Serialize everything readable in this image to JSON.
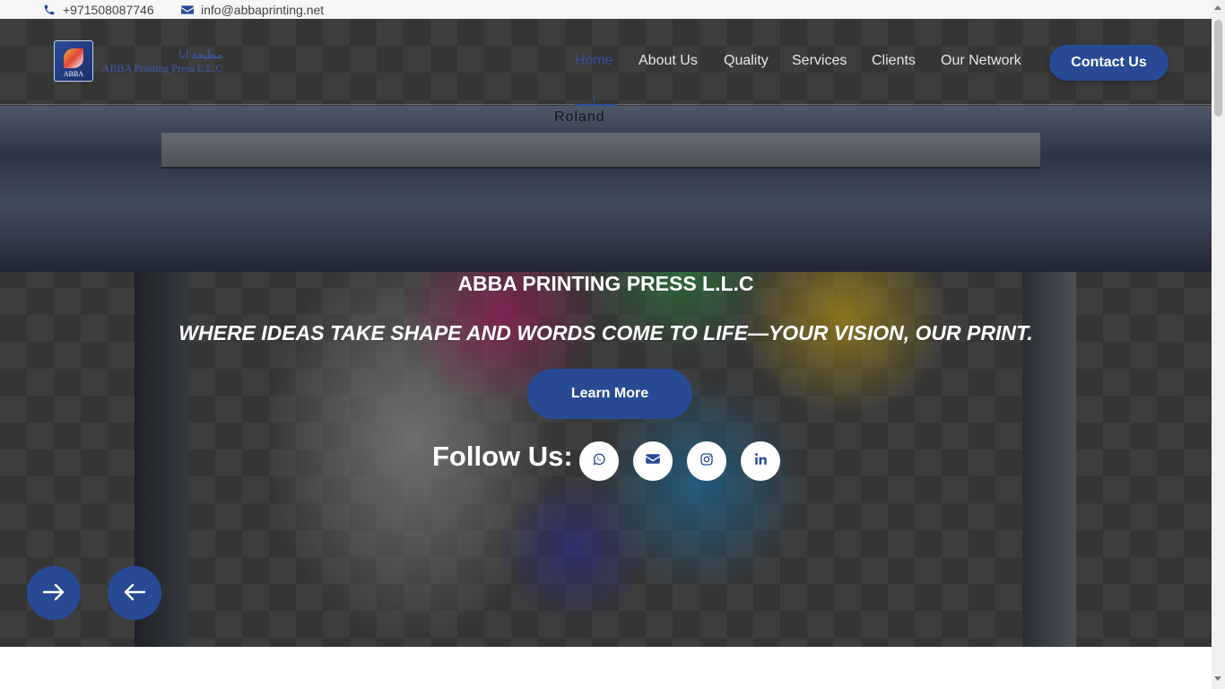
{
  "topbar": {
    "phone": "+971508087746",
    "phone_icon": "phone-icon",
    "email": "info@abbaprinting.net",
    "email_icon": "envelope-icon"
  },
  "logo": {
    "arabic": "مطبعة ابا",
    "english": "ABBA Printing Press L.L.C",
    "mark_text": "ABBA"
  },
  "nav": {
    "items": [
      {
        "label": "Home",
        "active": true
      },
      {
        "label": "About Us"
      },
      {
        "label": "Quality"
      },
      {
        "label": "Services"
      },
      {
        "label": "Clients"
      },
      {
        "label": "Our Network"
      }
    ],
    "contact_label": "Contact Us"
  },
  "hero": {
    "title": "ABBA PRINTING PRESS L.L.C",
    "subtitle": "WHERE IDEAS TAKE SHAPE AND WORDS COME TO LIFE—YOUR VISION, OUR PRINT.",
    "cta_label": "Learn More",
    "follow_label": "Follow Us:",
    "printer_brand": "Roland",
    "social": [
      "whatsapp-icon",
      "envelope-icon",
      "instagram-icon",
      "linkedin-icon"
    ]
  },
  "slider": {
    "next_icon": "arrow-right-icon",
    "prev_icon": "arrow-left-icon"
  },
  "colors": {
    "primary": "#284a94",
    "topbar_bg": "#f6f6f6",
    "nav_text": "#e6e6e6"
  }
}
